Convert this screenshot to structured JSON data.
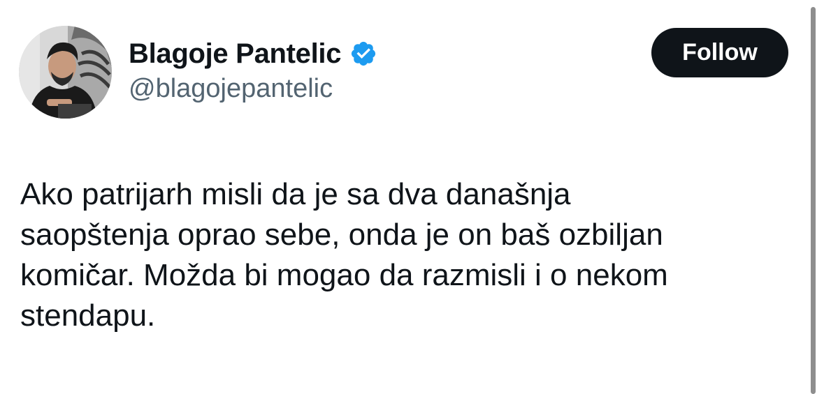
{
  "author": {
    "display_name": "Blagoje Pantelic",
    "handle": "@blagojepantelic",
    "verified": true,
    "verified_color": "#1d9bf0"
  },
  "follow_button": {
    "label": "Follow"
  },
  "tweet": {
    "lines": [
      "Ako patrijarh misli da je sa dva današnja",
      "saopštenja oprao sebe, onda je on baš ozbiljan",
      "komičar. Možda bi mogao da razmisli i o nekom",
      "stendapu."
    ]
  },
  "icons": {
    "verified": "verified-badge-icon",
    "avatar": "profile-photo"
  },
  "colors": {
    "text_primary": "#0f1419",
    "text_secondary": "#536471",
    "button_bg": "#0f1419",
    "button_text": "#ffffff"
  }
}
